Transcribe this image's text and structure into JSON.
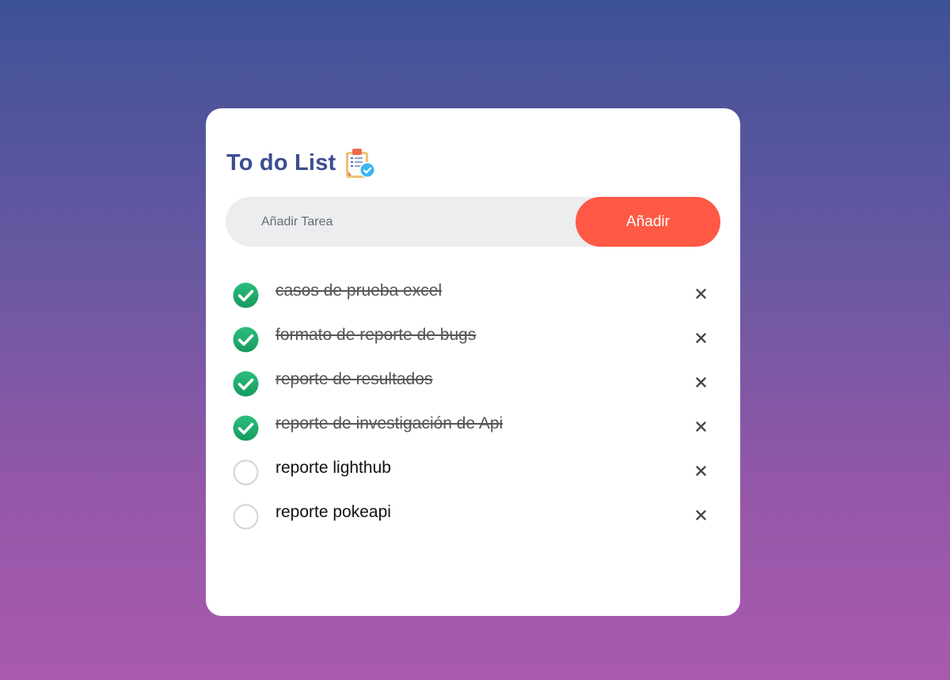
{
  "header": {
    "title": "To do List",
    "title_icon": "clipboard-check-icon"
  },
  "input": {
    "placeholder": "Añadir Tarea",
    "value": "",
    "add_label": "Añadir"
  },
  "colors": {
    "title": "#3c4d8f",
    "accent": "#ff5945",
    "check": "#22a86c",
    "background_top": "#3e5296",
    "background_bottom": "#a95aad"
  },
  "tasks": [
    {
      "text": "casos de prueba excel",
      "done": true
    },
    {
      "text": "formato de reporte de bugs",
      "done": true
    },
    {
      "text": "reporte de resultados",
      "done": true
    },
    {
      "text": "reporte de investigación de Api",
      "done": true
    },
    {
      "text": "reporte lighthub",
      "done": false
    },
    {
      "text": "reporte pokeapi",
      "done": false
    }
  ],
  "icons": {
    "checked": "checked-circle-icon",
    "unchecked": "unchecked-circle-icon",
    "delete": "close-icon"
  }
}
